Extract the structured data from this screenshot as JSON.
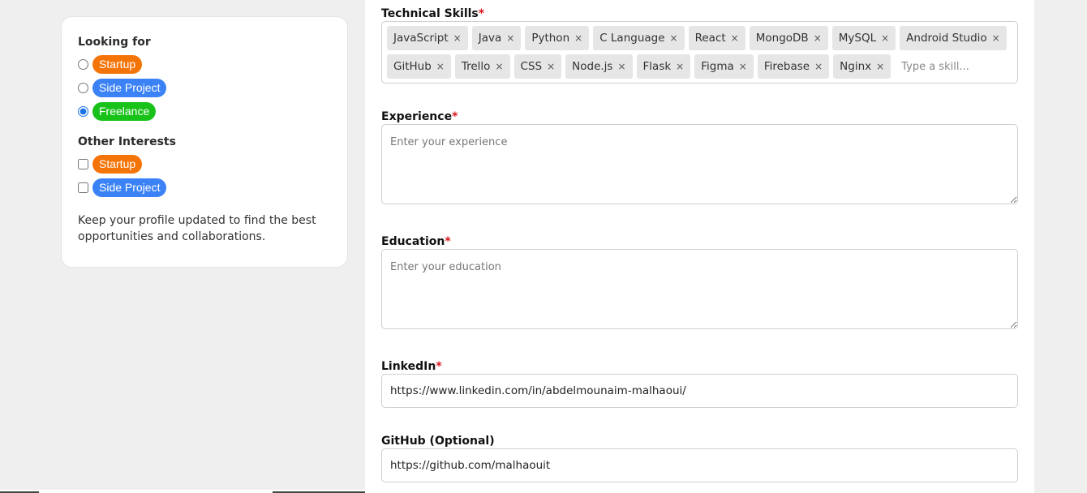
{
  "sidebar": {
    "looking_for": {
      "heading": "Looking for",
      "options": [
        {
          "label": "Startup",
          "color": "#f57408",
          "checked": false
        },
        {
          "label": "Side Project",
          "color": "#3b82f6",
          "checked": false
        },
        {
          "label": "Freelance",
          "color": "#19c219",
          "checked": true
        }
      ]
    },
    "other_interests": {
      "heading": "Other Interests",
      "options": [
        {
          "label": "Startup",
          "color": "#f57408",
          "checked": false
        },
        {
          "label": "Side Project",
          "color": "#3b82f6",
          "checked": false
        }
      ]
    },
    "note": "Keep your profile updated to find the best opportunities and collaborations."
  },
  "form": {
    "required_mark": "*",
    "technical_skills": {
      "label": "Technical Skills",
      "tags": [
        "JavaScript",
        "Java",
        "Python",
        "C Language",
        "React",
        "MongoDB",
        "MySQL",
        "Android Studio",
        "GitHub",
        "Trello",
        "CSS",
        "Node.js",
        "Flask",
        "Figma",
        "Firebase",
        "Nginx"
      ],
      "remove_glyph": "×",
      "placeholder": "Type a skill..."
    },
    "experience": {
      "label": "Experience",
      "placeholder": "Enter your experience",
      "value": ""
    },
    "education": {
      "label": "Education",
      "placeholder": "Enter your education",
      "value": ""
    },
    "linkedin": {
      "label": "LinkedIn",
      "value": "https://www.linkedin.com/in/abdelmounaim-malhaoui/"
    },
    "github": {
      "label": "GitHub (Optional)",
      "value": "https://github.com/malhaouit"
    }
  }
}
